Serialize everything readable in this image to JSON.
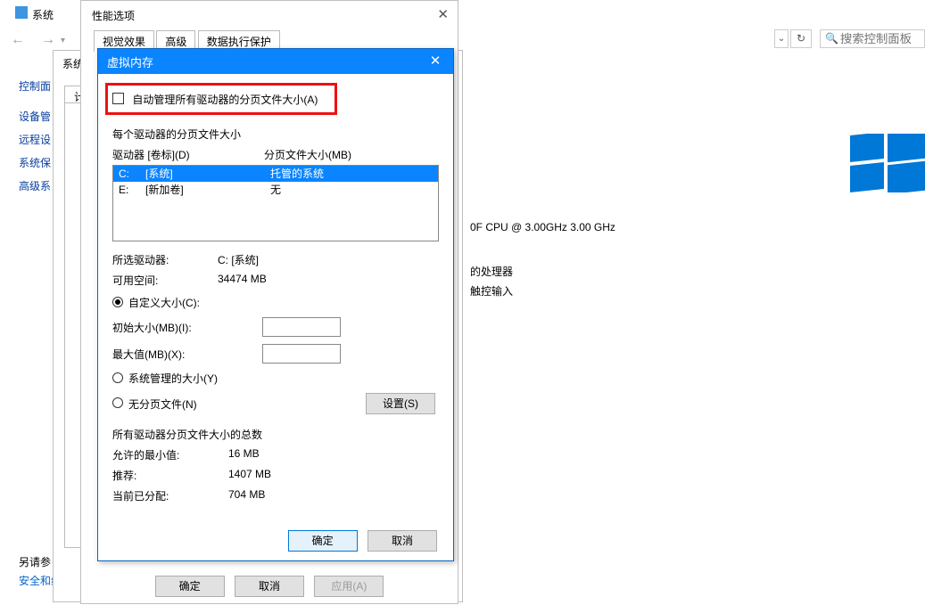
{
  "explorer": {
    "title": "系统",
    "search_placeholder": "搜索控制面板"
  },
  "leftnav": {
    "items": [
      "控制面",
      "设备管",
      "远程设",
      "系统保",
      "高级系"
    ]
  },
  "bottom_hint": {
    "line1": "另请参",
    "line2": "安全和维护"
  },
  "right_snippets": {
    "cpu": "0F CPU @ 3.00GHz   3.00 GHz",
    "proc": "的处理器",
    "touch": "触控输入"
  },
  "sysprops": {
    "title": "系统属性",
    "tabs": [
      "计算"
    ]
  },
  "perf": {
    "title": "性能选项",
    "tabs": [
      "视觉效果",
      "高级",
      "数据执行保护"
    ],
    "buttons": {
      "ok": "确定",
      "cancel": "取消",
      "apply": "应用(A)"
    }
  },
  "vm": {
    "title": "虚拟内存",
    "auto_label": "自动管理所有驱动器的分页文件大小(A)",
    "section_label": "每个驱动器的分页文件大小",
    "drive_header": {
      "col1": "驱动器 [卷标](D)",
      "col2": "分页文件大小(MB)"
    },
    "drives": [
      {
        "letter": "C:",
        "label": "[系统]",
        "size": "托管的系统",
        "selected": true
      },
      {
        "letter": "E:",
        "label": "[新加卷]",
        "size": "无",
        "selected": false
      }
    ],
    "selected_drive_label": "所选驱动器:",
    "selected_drive_value": "C:  [系统]",
    "free_space_label": "可用空间:",
    "free_space_value": "34474 MB",
    "radio_custom": "自定义大小(C):",
    "initial_label": "初始大小(MB)(I):",
    "max_label": "最大值(MB)(X):",
    "radio_system": "系统管理的大小(Y)",
    "radio_none": "无分页文件(N)",
    "set_btn": "设置(S)",
    "totals_header": "所有驱动器分页文件大小的总数",
    "min_label": "允许的最小值:",
    "min_value": "16 MB",
    "rec_label": "推荐:",
    "rec_value": "1407 MB",
    "cur_label": "当前已分配:",
    "cur_value": "704 MB",
    "ok": "确定",
    "cancel": "取消"
  }
}
